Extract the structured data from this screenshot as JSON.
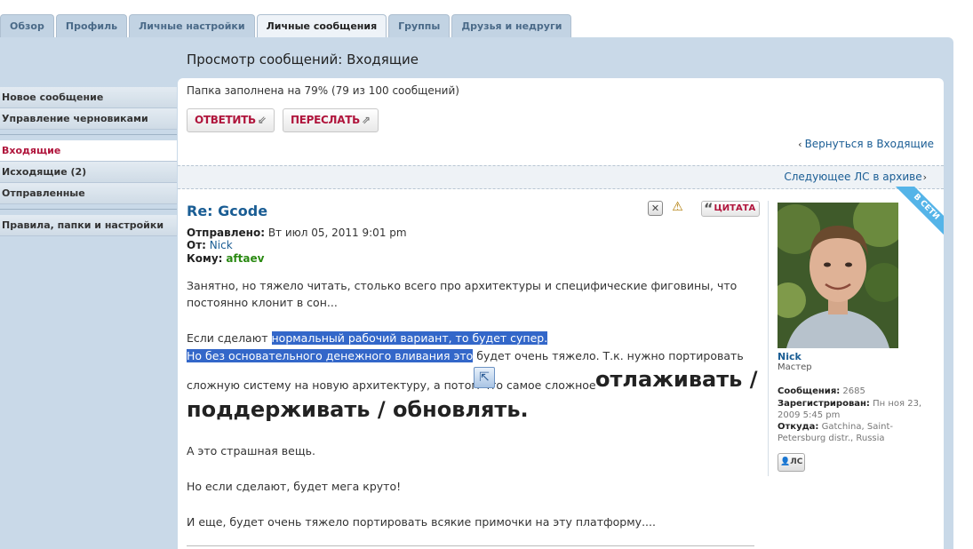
{
  "tabs": [
    "Обзор",
    "Профиль",
    "Личные настройки",
    "Личные сообщения",
    "Группы",
    "Друзья и недруги"
  ],
  "sidebar": {
    "new_message": "Новое сообщение",
    "drafts": "Управление черновиками",
    "inbox": "Входящие",
    "outbox": "Исходящие (2)",
    "sent": "Отправленные",
    "rules": "Правила, папки и настройки"
  },
  "page_title": "Просмотр сообщений: Входящие",
  "folder_status": "Папка заполнена на 79% (79 из 100 сообщений)",
  "buttons": {
    "reply": "ОТВЕТИТЬ",
    "forward": "ПЕРЕСЛАТЬ"
  },
  "nav": {
    "back": "Вернуться в Входящие",
    "next": "Следующее ЛС в архиве"
  },
  "post": {
    "title": "Re: Gcode",
    "sent_label": "Отправлено:",
    "sent_value": "Вт июл 05, 2011 9:01 pm",
    "from_label": "От:",
    "from_value": "Nick",
    "to_label": "Кому:",
    "to_value": "aftaev",
    "quote_button": "ЦИТАТА",
    "p1_line1": "Занятно, но тяжело читать, столько всего про архитектуры и специфические фиговины, что",
    "p1_line2": "постоянно клонит в сон...",
    "p2_a": "Если сделают ",
    "p2_sel1": "нормальный рабочий вариант, то будет супер.",
    "p2_sel2": "Но без основательного денежного вливания это",
    "p2_b": " будет очень тяжело. Т.к. нужно портировать",
    "p2_c": "сложную систему на новую архитектуру, а потом ",
    "p2_d": "что",
    "p2_e": " самое сложное",
    "big1": "отлаживать /",
    "big2": "поддерживать / обновлять.",
    "p3": "А это страшная вещь.",
    "p4": "Но если сделают, будет мега круто!",
    "p5": "И еще, будет очень тяжело портировать всякие примочки на эту платформу...."
  },
  "profile": {
    "online": "В СЕТИ",
    "name": "Nick",
    "rank": "Мастер",
    "posts_label": "Сообщения:",
    "posts_value": "2685",
    "registered_label": "Зарегистрирован:",
    "registered_value_1": "Пн ноя 23,",
    "registered_value_2": "2009 5:45 pm",
    "from_label": "Откуда:",
    "from_value_1": "Gatchina, Saint-",
    "from_value_2": "Petersburg distr., Russia",
    "pm_button": "ЛС"
  },
  "colors": {
    "accent_red": "#b0153c",
    "link_blue": "#1a5d94",
    "frame_blue": "#c9d9e8",
    "selection": "#3367c9",
    "online_ribbon": "#55b4e8"
  }
}
